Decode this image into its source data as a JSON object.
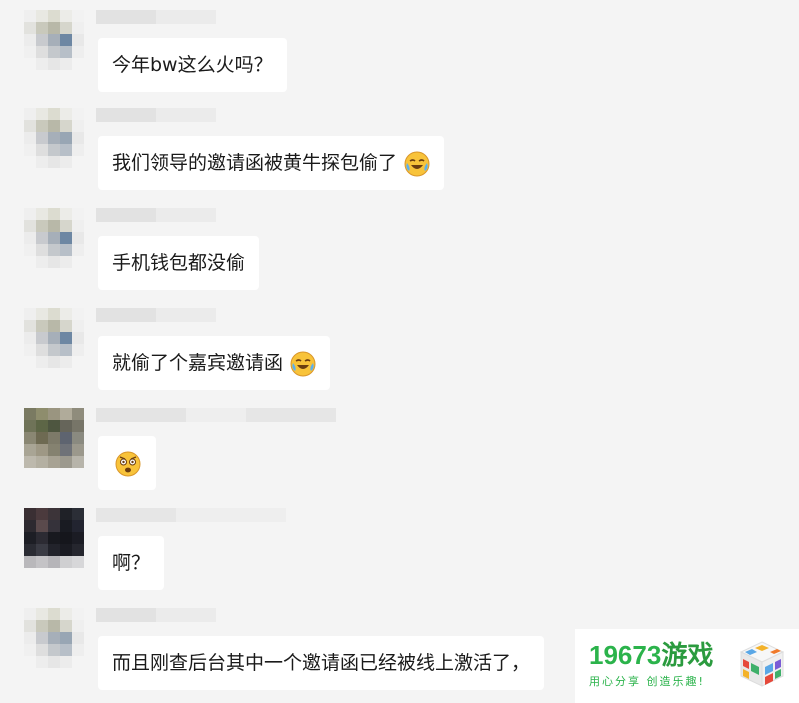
{
  "messages": [
    {
      "text": "今年bw这么火吗？",
      "emoji": ""
    },
    {
      "text": "我们领导的邀请函被黄牛探包偷了",
      "emoji": "laughing-crying-emoji"
    },
    {
      "text": "手机钱包都没偷",
      "emoji": ""
    },
    {
      "text": "就偷了个嘉宾邀请函",
      "emoji": "laughing-crying-emoji"
    },
    {
      "text": "",
      "emoji": "shocked-face-emoji"
    },
    {
      "text": "啊？",
      "emoji": ""
    },
    {
      "text": "而且刚查后台其中一个邀请函已经被线上激活了，",
      "emoji": ""
    }
  ],
  "watermark": {
    "title_num": "19673",
    "title_cn": "游戏",
    "slogan": "用心分享 创造乐趣!",
    "colors": {
      "green": "#2bb34b"
    }
  }
}
